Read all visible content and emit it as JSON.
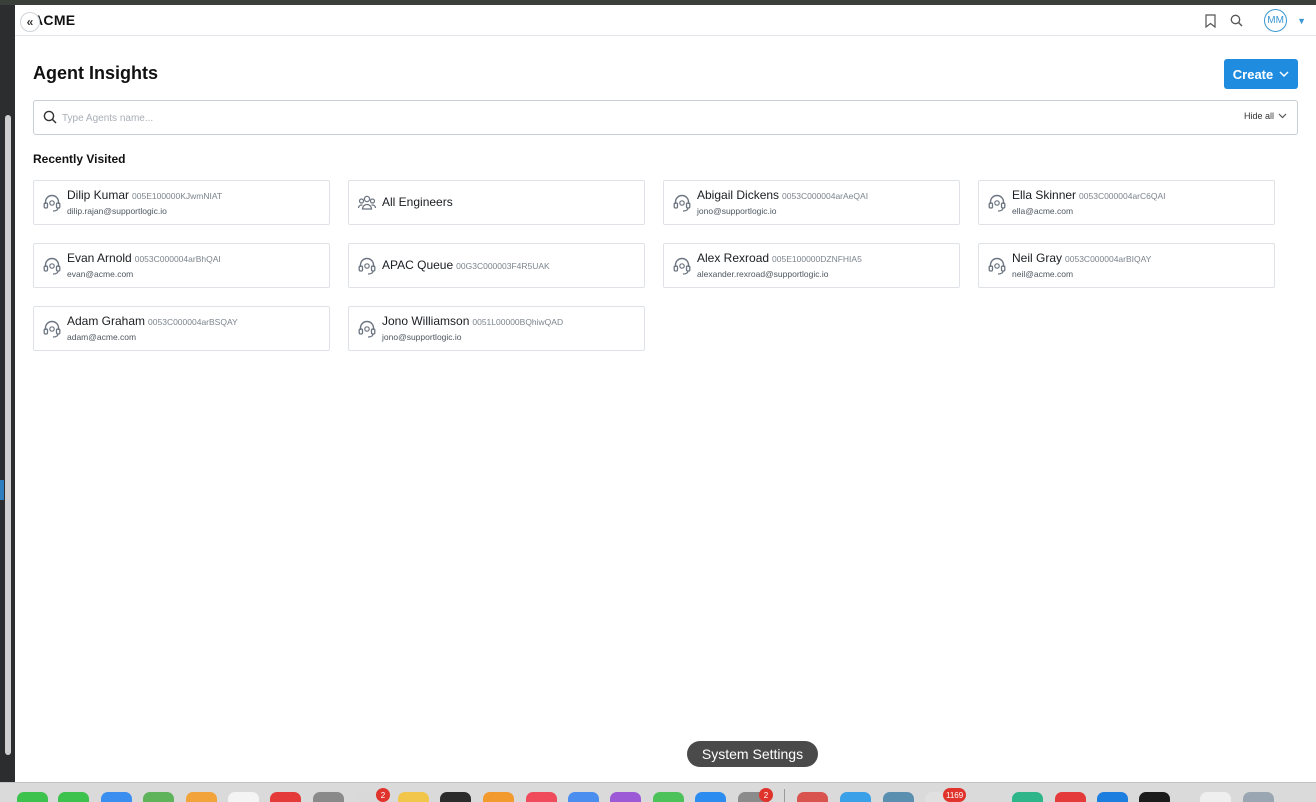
{
  "header": {
    "brand": "ACME",
    "avatar_initials": "MM"
  },
  "page": {
    "title": "Agent Insights",
    "create_label": "Create"
  },
  "search": {
    "placeholder": "Type Agents name...",
    "hide_all_label": "Hide all"
  },
  "recently_visited": {
    "title": "Recently Visited",
    "cards": [
      {
        "name": "Dilip Kumar",
        "id": "005E100000KJwmNIAT",
        "email": "dilip.rajan@supportlogic.io",
        "icon": "headset-icon"
      },
      {
        "name": "All Engineers",
        "id": "",
        "email": "",
        "icon": "group-icon"
      },
      {
        "name": "Abigail Dickens",
        "id": "0053C000004arAeQAI",
        "email": "jono@supportlogic.io",
        "icon": "headset-icon"
      },
      {
        "name": "Ella Skinner",
        "id": "0053C000004arC6QAI",
        "email": "ella@acme.com",
        "icon": "headset-icon"
      },
      {
        "name": "Evan Arnold",
        "id": "0053C000004arBhQAI",
        "email": "evan@acme.com",
        "icon": "headset-icon"
      },
      {
        "name": "APAC Queue",
        "id": "00G3C000003F4R5UAK",
        "email": "",
        "icon": "headset-icon"
      },
      {
        "name": "Alex Rexroad",
        "id": "005E100000DZNFHIA5",
        "email": "alexander.rexroad@supportlogic.io",
        "icon": "headset-icon"
      },
      {
        "name": "Neil Gray",
        "id": "0053C000004arBIQAY",
        "email": "neil@acme.com",
        "icon": "headset-icon"
      },
      {
        "name": "Adam Graham",
        "id": "0053C000004arBSQAY",
        "email": "adam@acme.com",
        "icon": "headset-icon"
      },
      {
        "name": "Jono Williamson",
        "id": "0051L00000BQhiwQAD",
        "email": "jono@supportlogic.io",
        "icon": "headset-icon"
      }
    ]
  },
  "dock": {
    "tooltip": "System Settings",
    "badges": [
      "2",
      "2",
      "1169"
    ]
  },
  "colors": {
    "accent": "#1f8ce0",
    "avatar": "#3b97d3"
  }
}
